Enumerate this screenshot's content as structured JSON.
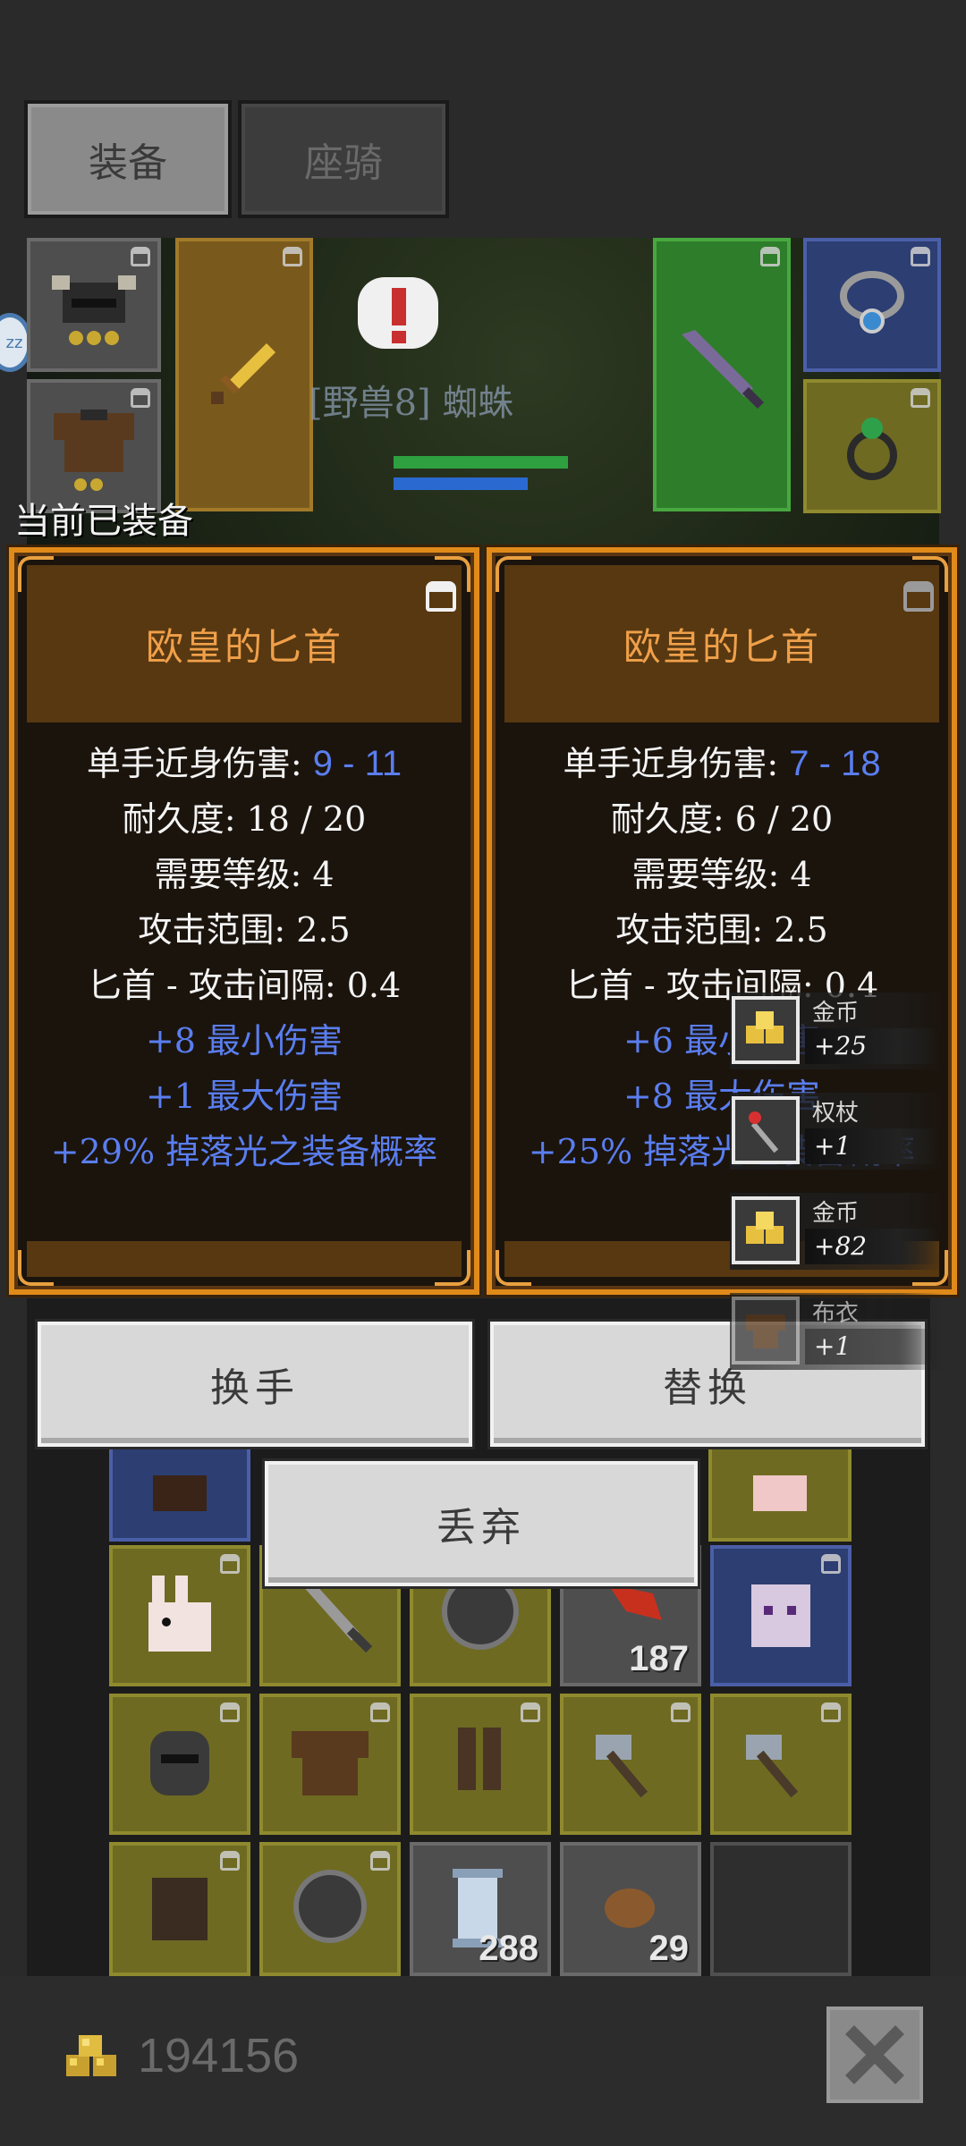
{
  "tabs": {
    "equip": "装备",
    "mount": "座骑"
  },
  "scene": {
    "monster_label": "[野兽8] 蜘蛛"
  },
  "current_equipped_label": "当前已装备",
  "left_card": {
    "title": "欧皇的匕首",
    "damage_label": "单手近身伤害: ",
    "damage_value": "9 - 11",
    "durability": "耐久度: 18 / 20",
    "level_req": "需要等级: 4",
    "range": "攻击范围: 2.5",
    "interval": "匕首 - 攻击间隔: 0.4",
    "bonus1": "+8 最小伤害",
    "bonus2": "+1 最大伤害",
    "bonus3": "+29% 掉落光之装备概率"
  },
  "right_card": {
    "title": "欧皇的匕首",
    "damage_label": "单手近身伤害: ",
    "damage_value": "7 - 18",
    "durability": "耐久度: 6 / 20",
    "level_req": "需要等级: 4",
    "range": "攻击范围: 2.5",
    "interval": "匕首 - 攻击间隔: 0.4",
    "bonus1": "+6 最小伤害",
    "bonus2": "+8 最大伤害",
    "bonus3": "+25% 掉落光之装备概率"
  },
  "loot": [
    {
      "name": "金币",
      "count": "+25",
      "icon": "gold-coins-icon"
    },
    {
      "name": "权杖",
      "count": "+1",
      "icon": "scepter-icon"
    },
    {
      "name": "金币",
      "count": "+82",
      "icon": "gold-coins-icon"
    },
    {
      "name": "布衣",
      "count": "+1",
      "icon": "cloth-armor-icon"
    }
  ],
  "buttons": {
    "swap_hand": "换手",
    "replace": "替换",
    "discard": "丢弃"
  },
  "inventory_counts": {
    "feather": "187",
    "scroll": "288",
    "meat": "29"
  },
  "gold_total": "194156",
  "side_badge": "zz",
  "colors": {
    "panel_border": "#e08a1a",
    "title": "#f0a04a",
    "bonus_blue": "#5a7ef0"
  }
}
